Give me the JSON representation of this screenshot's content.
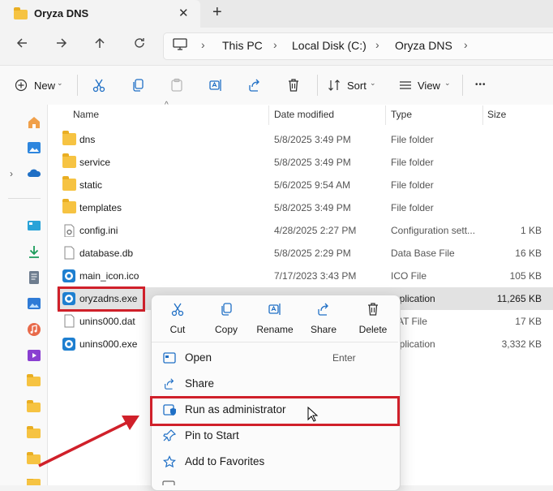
{
  "window": {
    "tab_title": "Oryza DNS",
    "close_glyph": "✕",
    "newtab_glyph": "+"
  },
  "breadcrumb": {
    "items": [
      "This PC",
      "Local Disk (C:)",
      "Oryza DNS"
    ],
    "separator": "›"
  },
  "toolbar": {
    "new_label": "New",
    "sort_label": "Sort",
    "view_label": "View",
    "more_glyph": "•••"
  },
  "columns": {
    "name": "Name",
    "date": "Date modified",
    "type": "Type",
    "size": "Size"
  },
  "files": [
    {
      "name": "dns",
      "date": "5/8/2025 3:49 PM",
      "type": "File folder",
      "size": "",
      "icon": "folder-icon"
    },
    {
      "name": "service",
      "date": "5/8/2025 3:49 PM",
      "type": "File folder",
      "size": "",
      "icon": "folder-icon"
    },
    {
      "name": "static",
      "date": "5/6/2025 9:54 AM",
      "type": "File folder",
      "size": "",
      "icon": "folder-icon"
    },
    {
      "name": "templates",
      "date": "5/8/2025 3:49 PM",
      "type": "File folder",
      "size": "",
      "icon": "folder-icon"
    },
    {
      "name": "config.ini",
      "date": "4/28/2025 2:27 PM",
      "type": "Configuration sett...",
      "size": "1 KB",
      "icon": "settings-file-icon"
    },
    {
      "name": "database.db",
      "date": "5/8/2025 2:29 PM",
      "type": "Data Base File",
      "size": "16 KB",
      "icon": "file-icon"
    },
    {
      "name": "main_icon.ico",
      "date": "7/17/2023 3:43 PM",
      "type": "ICO File",
      "size": "105 KB",
      "icon": "app-icon"
    },
    {
      "name": "oryzadns.exe",
      "date": "",
      "type": "pplication",
      "size": "11,265 KB",
      "icon": "app-icon"
    },
    {
      "name": "unins000.dat",
      "date": "",
      "type": "AT File",
      "size": "17 KB",
      "icon": "file-icon"
    },
    {
      "name": "unins000.exe",
      "date": "",
      "type": "pplication",
      "size": "3,332 KB",
      "icon": "app-icon"
    }
  ],
  "context_menu": {
    "top_actions": [
      "Cut",
      "Copy",
      "Rename",
      "Share",
      "Delete"
    ],
    "items": [
      {
        "label": "Open",
        "accel": "Enter"
      },
      {
        "label": "Share",
        "accel": ""
      },
      {
        "label": "Run as administrator",
        "accel": ""
      },
      {
        "label": "Pin to Start",
        "accel": ""
      },
      {
        "label": "Add to Favorites",
        "accel": ""
      }
    ]
  },
  "colors": {
    "highlight_red": "#d0202a",
    "accent_blue": "#1f6fc5",
    "folder_yellow": "#f6c342"
  }
}
